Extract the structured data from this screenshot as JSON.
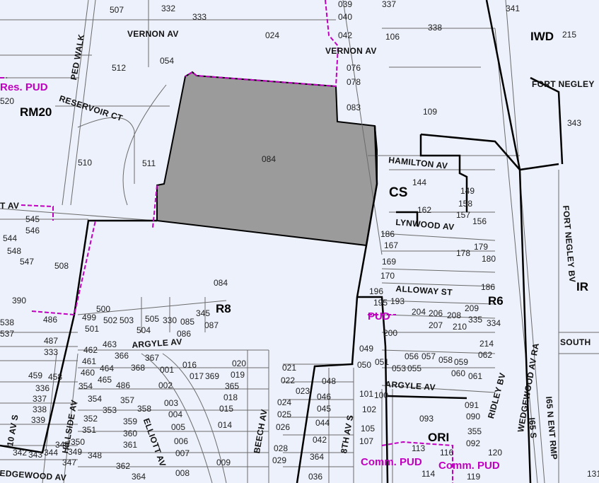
{
  "map": {
    "colors": {
      "background": "#edf1fb",
      "highlight_parcel": "#9b9b9b",
      "zone_line": "#000000",
      "pud_line": "#c000c0",
      "parcel_line": "#6a6a6a"
    },
    "streets": {
      "vernon_av_1": "VERNON AV",
      "vernon_av_2": "VERNON AV",
      "ped_walk": "PED WALK",
      "reservoir_ct": "RESERVOIR CT",
      "hamilton_av": "HAMILTON AV",
      "lynwood_av": "LYNWOOD AV",
      "alloway_st": "ALLOWAY ST",
      "argyle_av_1": "ARGYLE AV",
      "argyle_av_2": "ARGYLE AV",
      "fort_negley_1": "FORT NEGLEY",
      "fort_negley_bv": "FORT NEGLEY BV",
      "ridley_bv": "RIDLEY BV",
      "wedgewood_av_ra": "WEDGEWOOD AV RA",
      "i65_s": "I65 S",
      "i65_n_ent_rmp": "I65 N ENT RMP",
      "beech_av": "BEECH AV",
      "eighth_av_s": "8TH AV S",
      "elliott_av": "ELLIOTT AV",
      "hillside_av": "HILLSIDE AV",
      "tenth_av_s": "10 AV S",
      "edgewood_av": "EDGEWOOD AV",
      "south": "SOUTH",
      "t_av": "T AV"
    },
    "zones": {
      "rm20": "RM20",
      "r8": "R8",
      "r6": "R6",
      "cs": "CS",
      "iwd": "IWD",
      "ir": "IR",
      "orl": "ORI"
    },
    "overlays": {
      "res_pud": "Res. PUD",
      "pud": "PUD",
      "comm_pud_1": "Comm. PUD",
      "comm_pud_2": "Comm. PUD"
    },
    "parcels": {
      "p084_main": "084",
      "p084_lower": "084",
      "p507": "507",
      "p332": "332",
      "p333": "333",
      "p024": "024",
      "p039": "039",
      "p040": "040",
      "p042": "042",
      "p337": "337",
      "p106": "106",
      "p338": "338",
      "p341": "341",
      "p215": "215",
      "p512": "512",
      "p054": "054",
      "p076": "076",
      "p078": "078",
      "p083": "083",
      "p109": "109",
      "p343": "343",
      "p520": "520",
      "p510": "510",
      "p511": "511",
      "p144": "144",
      "p149": "149",
      "p545": "545",
      "p546": "546",
      "p544": "544",
      "p548": "548",
      "p547": "547",
      "p508": "508",
      "p390": "390",
      "p486": "486",
      "p487": "487",
      "p333b": "333",
      "p537": "537",
      "p538": "538",
      "p500": "500",
      "p499": "499",
      "p501": "501",
      "p502": "502",
      "p503": "503",
      "p505": "505",
      "p504": "504",
      "p330": "330",
      "p085": "085",
      "p086": "086",
      "p345": "345",
      "p087": "087",
      "p462": "462",
      "p463": "463",
      "p461": "461",
      "p460": "460",
      "p464": "464",
      "p465": "465",
      "p366": "366",
      "p367": "367",
      "p368": "368",
      "p016": "016",
      "p017": "017",
      "p369": "369",
      "p020": "020",
      "p019": "019",
      "p365": "365",
      "p018": "018",
      "p015": "015",
      "p014": "014",
      "p002": "002",
      "p003": "003",
      "p004": "004",
      "p005": "005",
      "p006": "006",
      "p007": "007",
      "p008": "008",
      "p009": "009",
      "p001": "001",
      "p486b": "486",
      "p357": "357",
      "p358": "358",
      "p359": "359",
      "p360": "360",
      "p361": "361",
      "p362": "362",
      "p364a": "364",
      "p459": "459",
      "p458": "458",
      "p336": "336",
      "p337b": "337",
      "p339": "339",
      "p338b": "338",
      "p354": "354",
      "p354b": "354",
      "p353": "353",
      "p352": "352",
      "p351": "351",
      "p350": "350",
      "p349": "349",
      "p348": "348",
      "p347": "347",
      "p342": "342",
      "p343b": "343",
      "p344": "344",
      "p345b": "345",
      "p021": "021",
      "p022": "022",
      "p023": "023",
      "p024b": "024",
      "p025": "025",
      "p026": "026",
      "p028": "028",
      "p029": "029",
      "p048": "048",
      "p046": "046",
      "p045": "045",
      "p044": "044",
      "p042b": "042",
      "p364": "364",
      "p036": "036",
      "p186": "186",
      "p167": "167",
      "p169": "169",
      "p170": "170",
      "p196": "196",
      "p195": "195",
      "p193": "193",
      "p200": "200",
      "p204": "204",
      "p206": "206",
      "p208": "208",
      "p209": "209",
      "p207": "207",
      "p210": "210",
      "p335": "335",
      "p334": "334",
      "p214": "214",
      "p062": "062",
      "p061": "061",
      "p060": "060",
      "p059": "059",
      "p058": "058",
      "p057": "057",
      "p056": "056",
      "p055": "055",
      "p053": "053",
      "p051": "051",
      "p050": "050",
      "p049": "049",
      "p180": "180",
      "p179": "179",
      "p178": "178",
      "p186b": "186",
      "p156": "156",
      "p157": "157",
      "p158": "158",
      "p162": "162",
      "p101": "101",
      "p100": "100",
      "p102": "102",
      "p105": "105",
      "p107": "107",
      "p093": "093",
      "p091": "091",
      "p090": "090",
      "p355": "355",
      "p092": "092",
      "p120": "120",
      "p113": "113",
      "p116": "116",
      "p119": "119",
      "p131": "131",
      "p114": "114"
    }
  }
}
